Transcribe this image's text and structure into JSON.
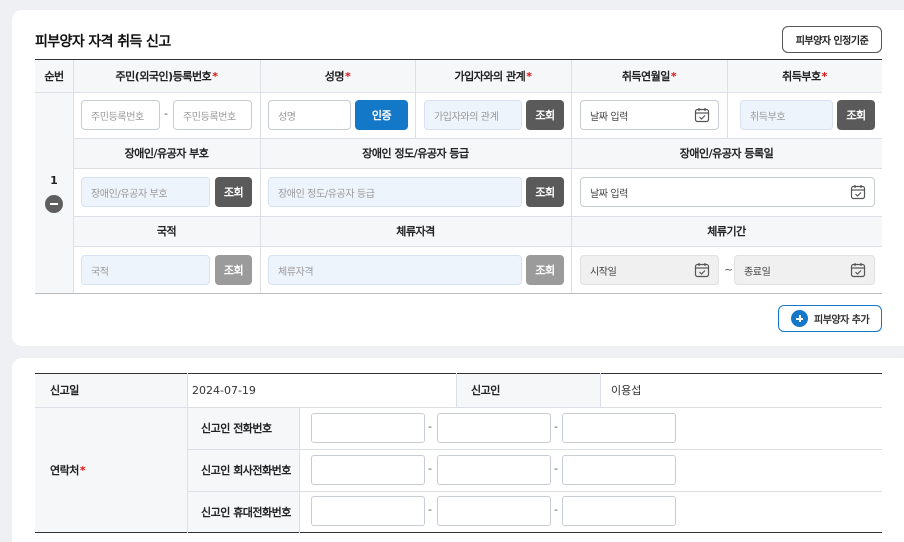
{
  "registration": {
    "title": "피부양자 자격 취득 신고",
    "criteria_button": "피부양자 인정기준",
    "headers": {
      "seq": "순번",
      "resident_no": "주민(외국인)등록번호",
      "name": "성명",
      "relation": "가입자와의 관계",
      "acq_date": "취득연월일",
      "acq_code": "취득부호",
      "disabled_code": "장애인/유공자 부호",
      "disabled_grade": "장애인 정도/유공자 등급",
      "disabled_date": "장애인/유공자 등록일",
      "nationality": "국적",
      "visa": "체류자격",
      "stay_period": "체류기간"
    },
    "required_mark": "*",
    "row_number": "1",
    "placeholders": {
      "resident_no": "주민등록번호",
      "name": "성명",
      "relation": "가입자와의 관계",
      "date": "날짜 입력",
      "acq_code": "취득부호",
      "disabled_code": "장애인/유공자 부호",
      "disabled_grade": "장애인 정도/유공자 등급",
      "nationality": "국적",
      "visa": "체류자격",
      "start_date": "시작일",
      "end_date": "종료일"
    },
    "buttons": {
      "verify": "인증",
      "lookup": "조회",
      "add_dependent": "피부양자 추가"
    },
    "separators": {
      "dash": "-",
      "tilde": "~"
    }
  },
  "report": {
    "date_label": "신고일",
    "date_value": "2024-07-19",
    "reporter_label": "신고인",
    "reporter_value": "이용섭",
    "contact_label": "연락처",
    "phone_labels": [
      "신고인 전화번호",
      "신고인 회사전화번호",
      "신고인 휴대전화번호"
    ]
  },
  "colors": {
    "primary": "#1478c8",
    "dark_button": "#5a5a5a",
    "required": "#dd1111"
  }
}
